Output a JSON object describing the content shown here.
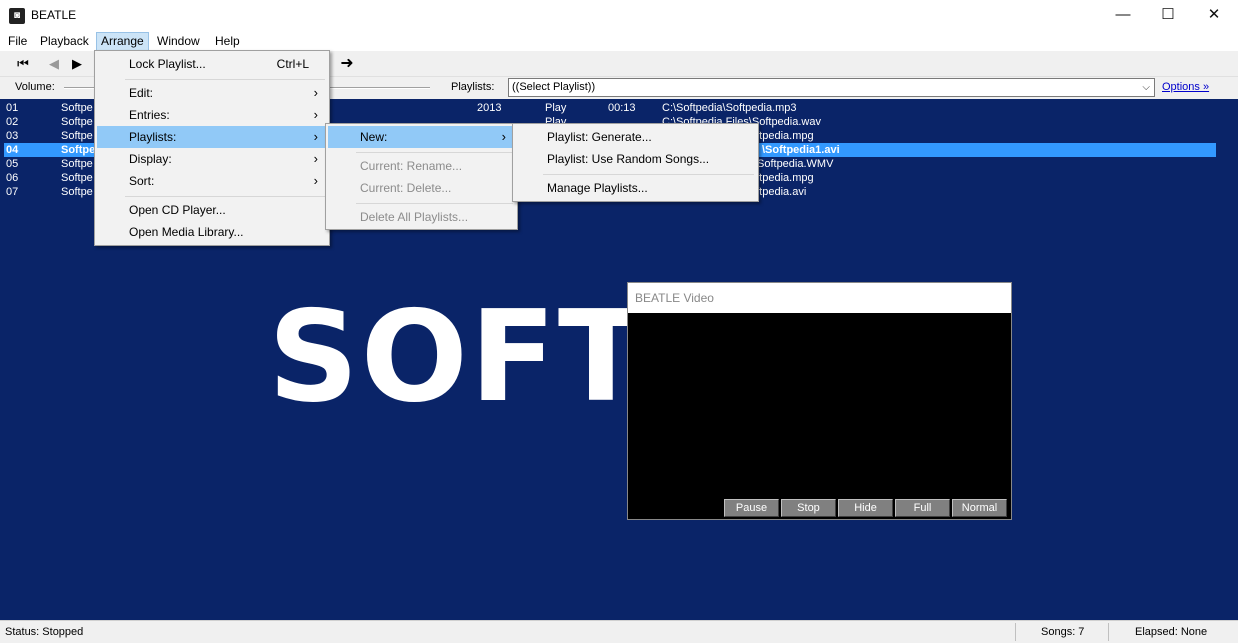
{
  "window": {
    "title": "BEATLE",
    "app_icon": "beatle-app-icon"
  },
  "menubar": [
    "File",
    "Playback",
    "Arrange",
    "Window",
    "Help"
  ],
  "controls": {
    "volume_label": "Volume:",
    "playlists_label": "Playlists:",
    "playlist_select_value": "((Select Playlist))",
    "options_link": "Options »"
  },
  "playlist_rows": [
    {
      "num": "01",
      "title": "Softpe",
      "year": "2013",
      "status": "Play",
      "time": "00:13",
      "path": "C:\\Softpedia\\Softpedia.mp3"
    },
    {
      "num": "02",
      "title": "Softpe",
      "year": "",
      "status": "Play",
      "time": "",
      "path": "C:\\Softpedia Files\\Softpedia.wav"
    },
    {
      "num": "03",
      "title": "Softpe",
      "year": "",
      "status": "",
      "time": "",
      "path": "oftpedia.mpg"
    },
    {
      "num": "04",
      "title": "Softpe",
      "year": "",
      "status": "",
      "time": "",
      "path": "\\Softpedia1.avi"
    },
    {
      "num": "05",
      "title": "Softpe",
      "year": "",
      "status": "",
      "time": "",
      "path": "Softpedia.WMV"
    },
    {
      "num": "06",
      "title": "Softpe",
      "year": "",
      "status": "",
      "time": "",
      "path": "oftpedia.mpg"
    },
    {
      "num": "07",
      "title": "Softpe",
      "year": "",
      "status": "",
      "time": "",
      "path": "oftpedia.avi"
    }
  ],
  "watermark_text": "SOFTI",
  "arrange_menu": {
    "lock_playlist": "Lock Playlist...",
    "lock_shortcut": "Ctrl+L",
    "edit": "Edit:",
    "entries": "Entries:",
    "playlists": "Playlists:",
    "display": "Display:",
    "sort": "Sort:",
    "open_cd": "Open CD Player...",
    "open_library": "Open Media Library..."
  },
  "playlists_submenu": {
    "new": "New:",
    "rename": "Current:  Rename...",
    "delete": "Current:  Delete...",
    "delete_all": "Delete All Playlists..."
  },
  "new_submenu": {
    "generate": "Playlist:  Generate...",
    "random": "Playlist:  Use Random Songs...",
    "manage": "Manage Playlists..."
  },
  "video": {
    "title": "BEATLE Video",
    "buttons": [
      "Pause",
      "Stop",
      "Hide",
      "Full",
      "Normal"
    ]
  },
  "status": {
    "status_text": "Status:  Stopped",
    "songs_text": "Songs:  7",
    "elapsed_text": "Elapsed:  None"
  },
  "colors": {
    "playlist_bg": "#0a2468",
    "selection": "#3399ff",
    "menu_highlight": "#91c9f7"
  }
}
